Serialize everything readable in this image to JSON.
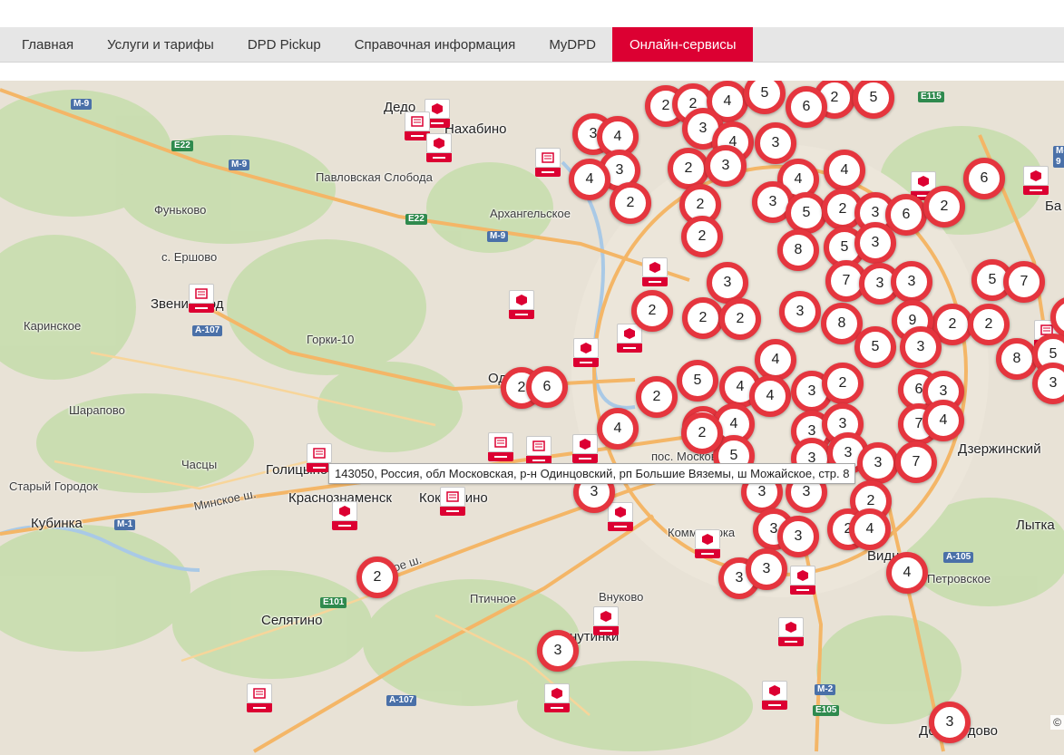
{
  "nav": {
    "items": [
      {
        "label": "Главная"
      },
      {
        "label": "Услуги и тарифы"
      },
      {
        "label": "DPD Pickup"
      },
      {
        "label": "Справочная информация"
      },
      {
        "label": "MyDPD"
      },
      {
        "label": "Онлайн-сервисы",
        "active": true
      }
    ]
  },
  "colors": {
    "accent": "#dc0032",
    "cluster_ring": "#e5353e",
    "nav_bg": "#e6e6e6"
  },
  "map": {
    "places": [
      {
        "text": "Дедо"
      },
      {
        "text": "Нахабино"
      },
      {
        "text": "Павловская Слобода"
      },
      {
        "text": "Фуньково"
      },
      {
        "text": "Архангельское"
      },
      {
        "text": "с. Ершово"
      },
      {
        "text": "Звенигород"
      },
      {
        "text": "Каринское"
      },
      {
        "text": "Горки-10"
      },
      {
        "text": "Шарапово"
      },
      {
        "text": "Часцы"
      },
      {
        "text": "Голицыно"
      },
      {
        "text": "Старый Городок"
      },
      {
        "text": "Краснознаменск"
      },
      {
        "text": "Кубинка"
      },
      {
        "text": "Коммунарка"
      },
      {
        "text": "Птичное"
      },
      {
        "text": "Селятино"
      },
      {
        "text": "Дзержинский"
      },
      {
        "text": "Лытка"
      },
      {
        "text": "Видное"
      },
      {
        "text": "Петровское"
      },
      {
        "text": "Домодедово"
      },
      {
        "text": "Минское ш."
      },
      {
        "text": "ое ш."
      },
      {
        "text": "Внуково"
      },
      {
        "text": "Ба"
      },
      {
        "text": "пос. Московский"
      },
      {
        "text": "Одинцово"
      },
      {
        "text": "Кокошкино"
      },
      {
        "text": "Внутинки"
      }
    ],
    "roads": [
      {
        "text": "M-9"
      },
      {
        "text": "E22"
      },
      {
        "text": "M-9"
      },
      {
        "text": "E22"
      },
      {
        "text": "M-9"
      },
      {
        "text": "A-107"
      },
      {
        "text": "M-1"
      },
      {
        "text": "E101"
      },
      {
        "text": "A-107"
      },
      {
        "text": "M-2"
      },
      {
        "text": "E105"
      },
      {
        "text": "A-105"
      },
      {
        "text": "E115"
      },
      {
        "text": "M-9"
      }
    ],
    "clusters": [
      "2",
      "2",
      "4",
      "5",
      "2",
      "5",
      "6",
      "3",
      "4",
      "3",
      "4",
      "3",
      "3",
      "2",
      "3",
      "4",
      "4",
      "4",
      "2",
      "2",
      "3",
      "5",
      "2",
      "3",
      "6",
      "2",
      "6",
      "2",
      "2",
      "8",
      "5",
      "3",
      "3",
      "7",
      "3",
      "3",
      "5",
      "7",
      "2",
      "2",
      "2",
      "3",
      "8",
      "9",
      "2",
      "2",
      "5",
      "3",
      "8",
      "5",
      "3",
      "2",
      "6",
      "5",
      "4",
      "4",
      "4",
      "3",
      "2",
      "6",
      "3",
      "2",
      "4",
      "2",
      "4",
      "3",
      "3",
      "7",
      "4",
      "5",
      "3",
      "3",
      "3",
      "2",
      "7",
      "3",
      "3",
      "2",
      "3",
      "2",
      "4",
      "3",
      "3",
      "4",
      "2",
      "3",
      "3",
      "3",
      "3"
    ],
    "tooltip": "143050, Россия, обл Московская, р-н Одинцовский, рп Большие Вяземы, ш Можайское, стр. 8",
    "copyright": "©"
  }
}
